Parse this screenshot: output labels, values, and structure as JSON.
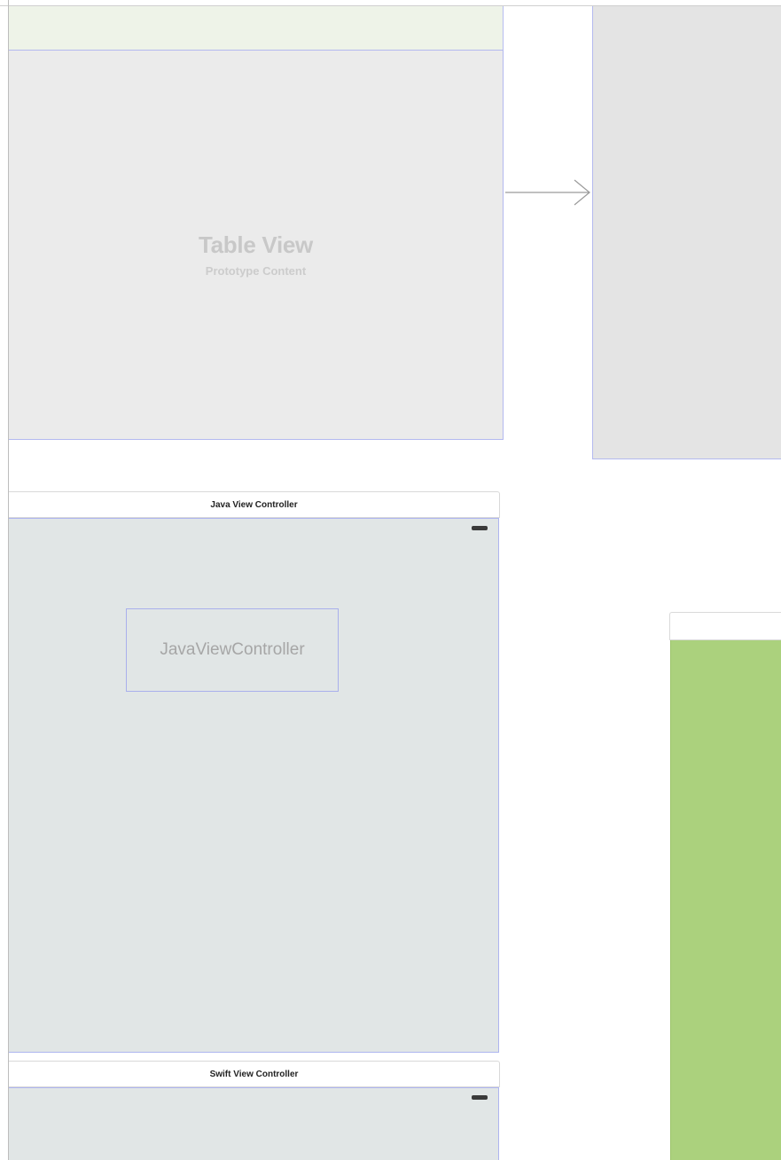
{
  "storyboard": {
    "table_view_scene": {
      "title": "Table View",
      "subtitle": "Prototype Content"
    },
    "java_scene": {
      "title": "Java View Controller",
      "label_text": "JavaViewController"
    },
    "swift_scene": {
      "title": "Swift View Controller"
    }
  },
  "colors": {
    "navbar_tint": "#eef3e8",
    "table_view_bg": "#ebebeb",
    "scene_view_bg": "#e1e6e6",
    "selection_border": "#b3b9ef",
    "green_view_bg": "#abd17d"
  },
  "icons": {
    "segue": "arrow-right-icon",
    "battery": "battery-icon"
  }
}
